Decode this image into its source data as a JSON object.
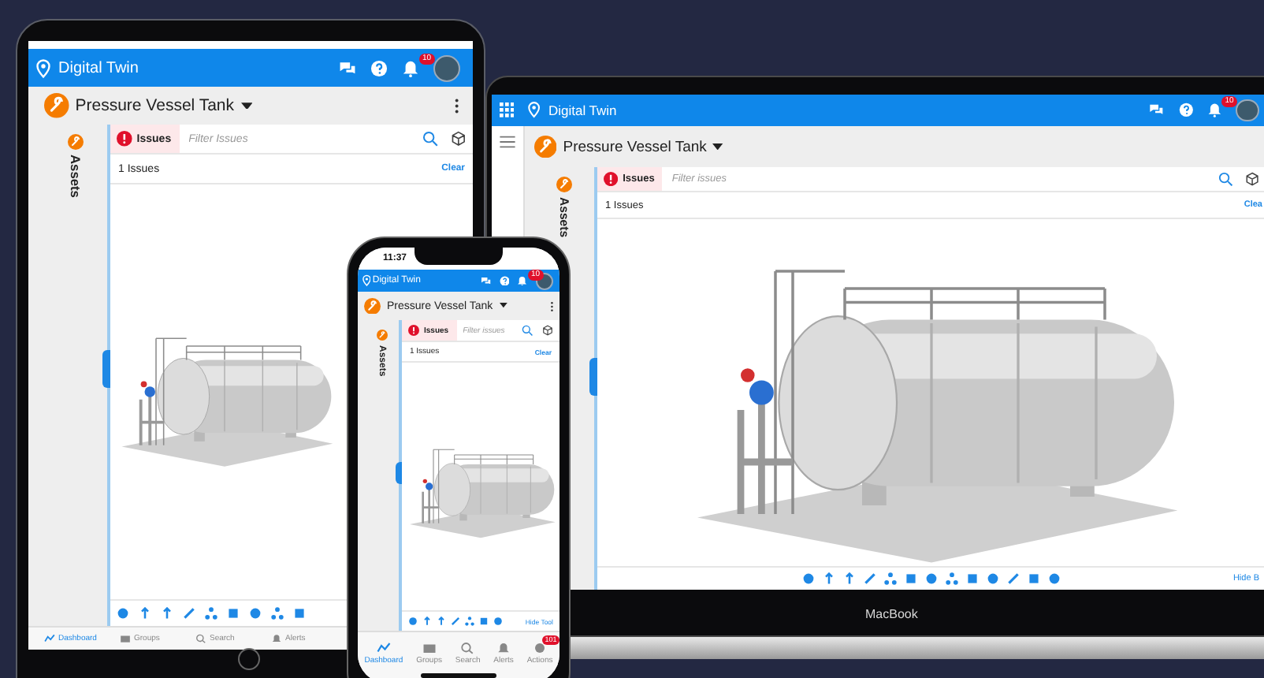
{
  "devices": [
    {
      "kind": "tablet",
      "header_title": "Digital Twin",
      "badge": "10",
      "asset_title": "Pressure Vessel Tank",
      "side_label": "Assets",
      "issues_label": "Issues",
      "filter_placeholder": "Filter Issues",
      "issue_count": "1 Issues",
      "clear_label": "Clear",
      "tabs": [
        {
          "label": "Dashboard",
          "selected": true
        },
        {
          "label": "Groups",
          "selected": false
        },
        {
          "label": "Search",
          "selected": false
        },
        {
          "label": "Alerts",
          "selected": false
        }
      ]
    },
    {
      "kind": "laptop",
      "header_title": "Digital Twin",
      "badge": "10",
      "asset_title": "Pressure Vessel Tank",
      "side_label": "Assets",
      "issues_label": "Issues",
      "filter_placeholder": "Filter issues",
      "issue_count": "1 Issues",
      "clear_label": "Clea",
      "toolbar_link": "Hide B",
      "device_label": "MacBook"
    },
    {
      "kind": "phone",
      "status_time": "11:37",
      "header_title": "Digital Twin",
      "badge": "10",
      "asset_title": "Pressure Vessel Tank",
      "side_label": "Assets",
      "issues_label": "Issues",
      "filter_placeholder": "Filter issues",
      "issue_count": "1 Issues",
      "clear_label": "Clear",
      "toolbar_link": "Hide Tool",
      "tabs": [
        {
          "label": "Dashboard",
          "selected": true
        },
        {
          "label": "Groups",
          "selected": false
        },
        {
          "label": "Search",
          "selected": false
        },
        {
          "label": "Alerts",
          "selected": false
        },
        {
          "label": "Actions",
          "selected": false,
          "badge": "101"
        }
      ]
    }
  ]
}
